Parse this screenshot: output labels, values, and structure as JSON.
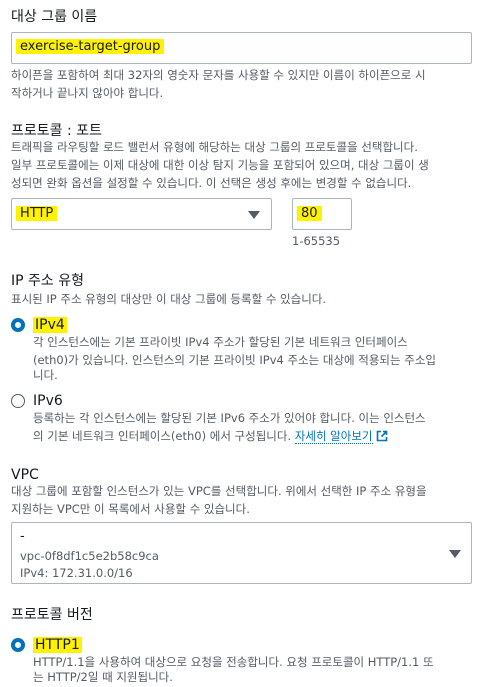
{
  "target_group_name": {
    "label": "대상 그룹 이름",
    "value": "exercise-target-group",
    "hint_line1": "하이픈을 포함하여 최대 32자의 영숫자 문자를 사용할 수 있지만 이름이 하이픈으로 시",
    "hint_line2": "작하거나 끝나지 않아야 합니다."
  },
  "protocol_port": {
    "label": "프로토콜 : 포트",
    "desc_line1": "트래픽을 라우팅할 로드 밸런서 유형에 해당하는 대상 그룹의 프로토콜을 선택합니다.",
    "desc_line2": "일부 프로토콜에는 이제 대상에 대한 이상 탐지 기능을 포함되어 있으며, 대상 그룹이 생",
    "desc_line3": "성되면 완화 옵션을 설정할 수 있습니다. 이 선택은 생성 후에는 변경할 수 없습니다.",
    "protocol_value": "HTTP",
    "port_value": "80",
    "port_range": "1-65535"
  },
  "ip_type": {
    "label": "IP 주소 유형",
    "desc": "표시된 IP 주소 유형의 대상만 이 대상 그룹에 등록할 수 있습니다.",
    "ipv4_label": "IPv4",
    "ipv4_desc_line1": "각 인스턴스에는 기본 프라이빗 IPv4 주소가 할당된 기본 네트워크 인터페이스",
    "ipv4_desc_line2": "(eth0)가 있습니다. 인스턴스의 기본 프라이빗 IPv4 주소는 대상에 적용되는 주소입",
    "ipv4_desc_line3": "니다.",
    "ipv6_label": "IPv6",
    "ipv6_desc_line1": "등록하는 각 인스턴스에는 할당된 기본 IPv6 주소가 있어야 합니다. 이는 인스턴스",
    "ipv6_desc_line2": "의 기본 네트워크 인터페이스(eth0) 에서 구성됩니다.",
    "learn_more": "자세히 알아보기",
    "selected": "IPv4"
  },
  "vpc": {
    "label": "VPC",
    "desc_line1": "대상 그룹에 포함할 인스턴스가 있는 VPC를 선택합니다. 위에서 선택한 IP 주소 유형을",
    "desc_line2": "지원하는 VPC만 이 목록에서 사용할 수 있습니다.",
    "selected_name": "-",
    "selected_id": "vpc-0f8df1c5e2b58c9ca",
    "selected_cidr": "IPv4: 172.31.0.0/16"
  },
  "protocol_version": {
    "label": "프로토콜 버전",
    "http1_label": "HTTP1",
    "http1_desc_line1": "HTTP/1.1을 사용하여 대상으로 요청을 전송합니다. 요청 프로토콜이 HTTP/1.1 또",
    "http1_desc_line2": "는 HTTP/2일 때 지원됩니다.",
    "selected": "HTTP1"
  },
  "colors": {
    "highlight": "#fff200",
    "accent": "#0073bb",
    "border": "#aab7b8",
    "secondary_text": "#545b64"
  }
}
